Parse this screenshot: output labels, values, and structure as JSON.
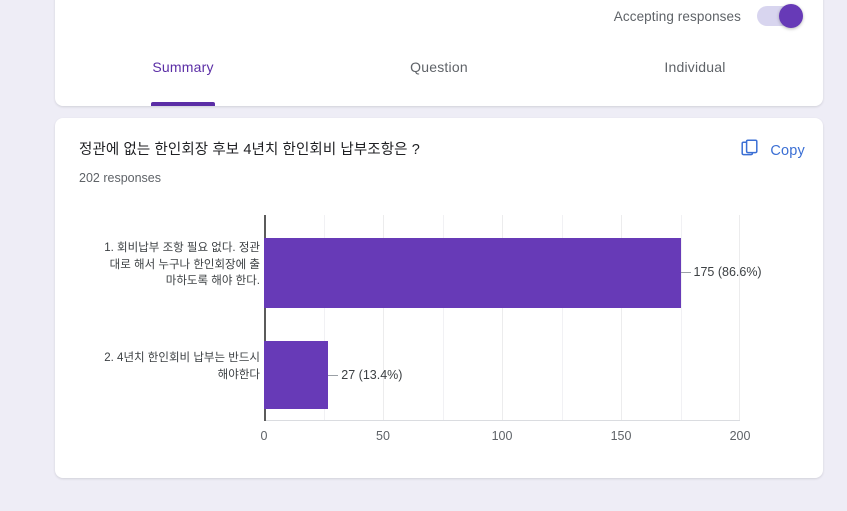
{
  "header": {
    "accepting_label": "Accepting responses",
    "toggle_state": "on"
  },
  "tabs": [
    {
      "label": "Summary",
      "active": true
    },
    {
      "label": "Question",
      "active": false
    },
    {
      "label": "Individual",
      "active": false
    }
  ],
  "question": {
    "title": "정관에 없는 한인회장 후보 4년치 한인회비 납부조항은 ?",
    "responses": "202 responses",
    "copy_label": "Copy",
    "copy_icon": "copy-icon"
  },
  "colors": {
    "bar": "#673ab7",
    "accent": "#5b2ea6",
    "link": "#3b6fd4",
    "page_bg": "#eeedf6",
    "card_bg": "#ffffff"
  },
  "chart_data": {
    "type": "bar",
    "orientation": "horizontal",
    "title": "정관에 없는 한인회장 후보 4년치 한인회비 납부조항은 ?",
    "xlabel": "",
    "ylabel": "",
    "xlim": [
      0,
      200
    ],
    "grid": true,
    "legend": "none",
    "total_responses": 202,
    "categories": [
      "1. 회비납부 조항 필요 없다. 정관\n대로 해서 누구나 한인회장에 출\n마하도록 해야 한다.",
      "2. 4년치 한인회비 납부는 반드시\n해야한다"
    ],
    "values": [
      175,
      27
    ],
    "percentages": [
      86.6,
      13.4
    ],
    "data_labels": [
      "175 (86.6%)",
      "27 (13.4%)"
    ],
    "ticks": [
      0,
      50,
      100,
      150,
      200
    ],
    "tick_labels": [
      "0",
      "50",
      "100",
      "150",
      "200"
    ]
  }
}
